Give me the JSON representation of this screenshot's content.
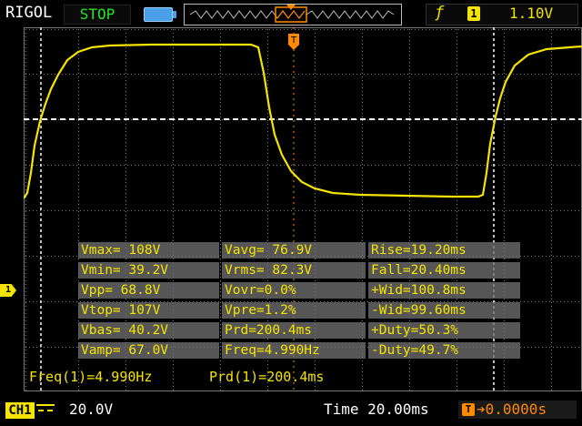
{
  "header": {
    "brand": "RIGOL",
    "run_state": "STOP",
    "trigger_source": "1",
    "trigger_level": "1.10V"
  },
  "measurements": {
    "rows": [
      [
        "Vmax= 108V",
        "Vavg= 76.9V",
        "Rise=19.20ms"
      ],
      [
        "Vmin= 39.2V",
        "Vrms= 82.3V",
        "Fall=20.40ms"
      ],
      [
        "Vpp= 68.8V",
        "Vovr=0.0%",
        "+Wid=100.8ms"
      ],
      [
        "Vtop= 107V",
        "Vpre=1.2%",
        "-Wid=99.60ms"
      ],
      [
        "Vbas= 40.2V",
        "Prd=200.4ms",
        "+Duty=50.3%"
      ],
      [
        "Vamp= 67.0V",
        "Freq=4.990Hz",
        "-Duty=49.7%"
      ]
    ]
  },
  "status": {
    "freq": "Freq(1)=4.990Hz",
    "period": "Prd(1)=200.4ms"
  },
  "footer": {
    "channel": "CH1",
    "ch1_scale": "20.0V",
    "timebase": "Time 20.00ms",
    "trigger_offset": "0.0000s"
  },
  "markers": {
    "channel_marker": "1",
    "trigger_marker": "T"
  },
  "colors": {
    "trace": "#f5e400",
    "run_state": "#22e822",
    "trigger_offset": "#ff8a00"
  },
  "icons": {
    "trigger_edge": "rising-edge-icon",
    "memory": "memory-depth-icon"
  }
}
